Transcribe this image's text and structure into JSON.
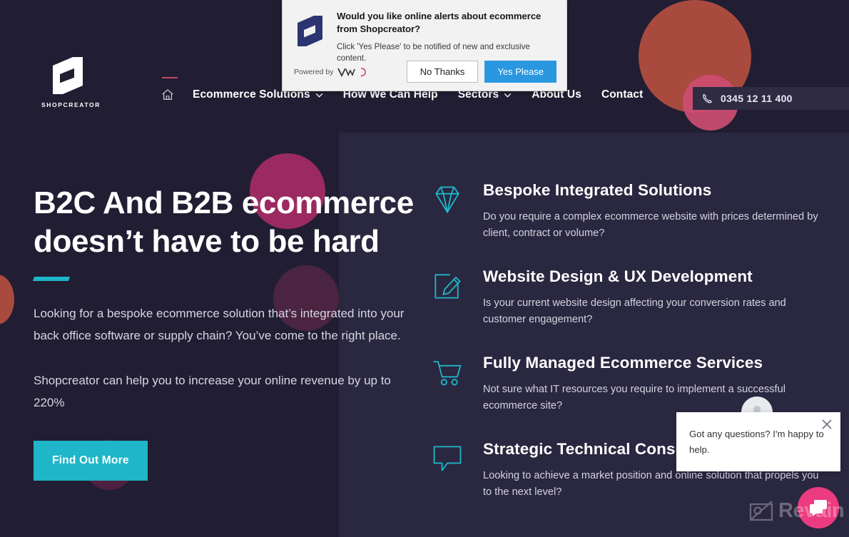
{
  "site": {
    "brand_name": "SHOPCREATOR",
    "logo_icon": "shopcreator-s-logo"
  },
  "colors": {
    "background": "#211e33",
    "panel": "#2a2740",
    "accent_teal": "#1eb6c8",
    "accent_magenta": "#9b2a61",
    "accent_red": "#a94a3e",
    "accent_pink": "#cd4d72",
    "chat_pink": "#ec3b80",
    "vwo_blue": "#2a97e0"
  },
  "nav": {
    "home_icon": "home-icon",
    "items": [
      {
        "label": "Ecommerce Solutions",
        "has_dropdown": true
      },
      {
        "label": "How We Can Help",
        "has_dropdown": false
      },
      {
        "label": "Sectors",
        "has_dropdown": true
      },
      {
        "label": "About Us",
        "has_dropdown": false
      },
      {
        "label": "Contact",
        "has_dropdown": false
      }
    ]
  },
  "phone": {
    "icon": "phone-icon",
    "number": "0345 12 11 400"
  },
  "hero": {
    "title_line1": "B2C And B2B ecommerce",
    "title_line2": "doesn’t have to be hard",
    "paragraph1": "Looking for a bespoke ecommerce solution that’s integrated into your back office software or supply chain? You’ve come to the right place.",
    "paragraph2": "Shopcreator can help you to increase your online revenue by up to 220%",
    "cta_label": "Find Out More"
  },
  "features": [
    {
      "icon": "diamond-icon",
      "title": "Bespoke Integrated Solutions",
      "description": "Do you require a complex ecommerce website with prices determined by client, contract or volume?"
    },
    {
      "icon": "pencil-edit-icon",
      "title": "Website Design & UX Development",
      "description": "Is your current website design affecting your conversion rates and customer engagement?"
    },
    {
      "icon": "shopping-cart-icon",
      "title": "Fully Managed Ecommerce Services",
      "description": "Not sure what IT resources you require to implement a successful ecommerce site?"
    },
    {
      "icon": "speech-bubble-icon",
      "title": "Strategic Technical Consulting",
      "description": "Looking to achieve a market position and online solution that propels you to the next level?"
    }
  ],
  "notification": {
    "logo_icon": "shopcreator-s-logo",
    "title": "Would you like online alerts about ecommerce from Shopcreator?",
    "subtitle": "Click 'Yes Please' to be notified of new and exclusive content.",
    "powered_by_label": "Powered by",
    "powered_by_brand": "VWO",
    "decline_label": "No Thanks",
    "accept_label": "Yes Please"
  },
  "chat": {
    "avatar_icon": "user-avatar-icon",
    "close_icon": "close-icon",
    "message": "Got any questions? I'm happy to help.",
    "fab_icon": "chat-bubbles-icon"
  },
  "watermark": {
    "icon": "image-placeholder-icon",
    "text": "Revain"
  }
}
